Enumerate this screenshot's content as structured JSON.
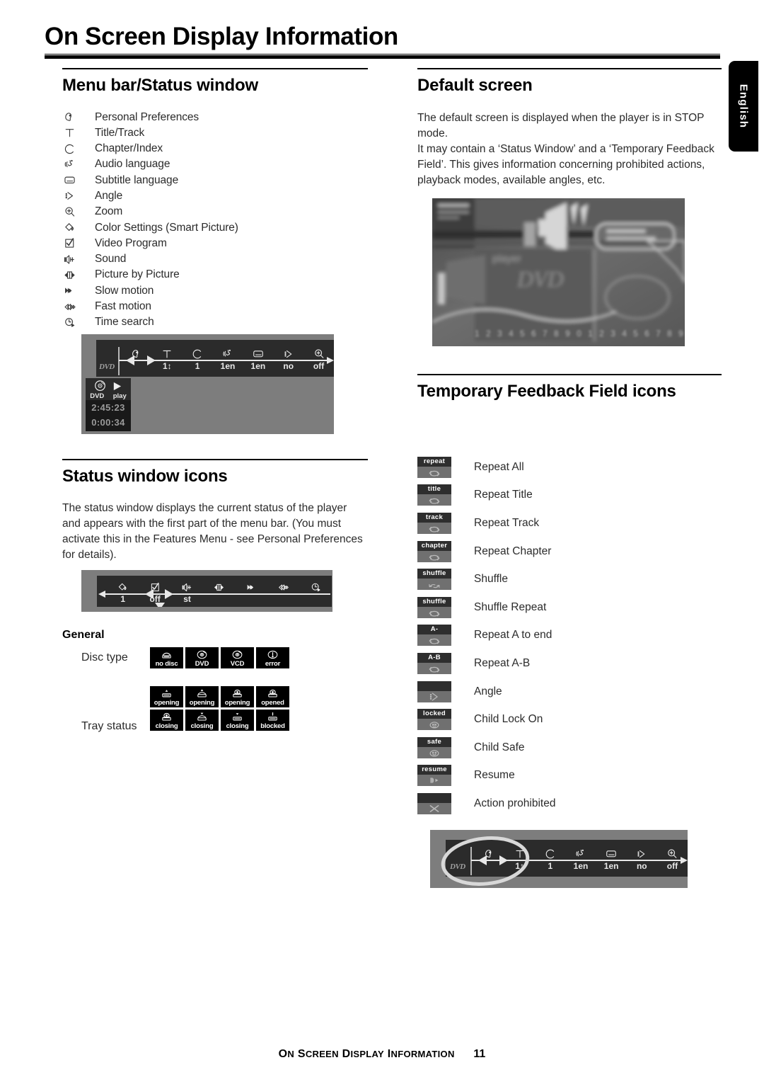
{
  "page": {
    "title": "On Screen Display Information",
    "language_tab": "English",
    "footer_title_parts": [
      "O",
      "N ",
      " S",
      "CREEN ",
      " D",
      "ISPLAY ",
      " I",
      "NFORMATION"
    ],
    "footer_title": "ON SCREEN DISPLAY INFORMATION",
    "page_number": "11"
  },
  "left_column": {
    "section1": {
      "heading": "Menu bar/Status window",
      "items": [
        {
          "icon": "personal-preferences-icon",
          "label": "Personal Preferences"
        },
        {
          "icon": "title-track-icon",
          "label": "Title/Track"
        },
        {
          "icon": "chapter-index-icon",
          "label": "Chapter/Index"
        },
        {
          "icon": "audio-language-icon",
          "label": "Audio language"
        },
        {
          "icon": "subtitle-language-icon",
          "label": "Subtitle language"
        },
        {
          "icon": "angle-icon",
          "label": "Angle"
        },
        {
          "icon": "zoom-icon",
          "label": "Zoom"
        },
        {
          "icon": "color-settings-icon",
          "label": "Color Settings (Smart Picture)"
        },
        {
          "icon": "video-program-icon",
          "label": "Video Program"
        },
        {
          "icon": "sound-icon",
          "label": "Sound"
        },
        {
          "icon": "picture-by-picture-icon",
          "label": "Picture by Picture"
        },
        {
          "icon": "slow-motion-icon",
          "label": "Slow motion"
        },
        {
          "icon": "fast-motion-icon",
          "label": "Fast motion"
        },
        {
          "icon": "time-search-icon",
          "label": "Time search"
        }
      ]
    },
    "menubar_figure": {
      "disc_logo": "DVD",
      "cells": [
        {
          "icon": "personal-preferences-icon",
          "value": ""
        },
        {
          "icon": "title-track-icon",
          "value": "1"
        },
        {
          "icon": "chapter-index-icon",
          "value": "1"
        },
        {
          "icon": "audio-language-icon",
          "value": "1en"
        },
        {
          "icon": "subtitle-language-icon",
          "value": "1en"
        },
        {
          "icon": "angle-icon",
          "value": "no"
        },
        {
          "icon": "zoom-icon",
          "value": "off"
        }
      ],
      "status_window": {
        "disc_type": "DVD",
        "state": "play",
        "total_time": "2:45:23",
        "elapsed_time": "0:00:34"
      }
    },
    "section2": {
      "heading": "Status window icons",
      "paragraph": "The status window displays the current status of the player and appears with the first part of the menu bar. (You must activate this in the Features Menu - see Personal Preferences for details).",
      "figure_cells": [
        {
          "icon": "color-settings-icon",
          "value": "1"
        },
        {
          "icon": "video-program-icon",
          "value": "off"
        },
        {
          "icon": "sound-icon",
          "value": "st"
        },
        {
          "icon": "picture-by-picture-icon",
          "value": ""
        },
        {
          "icon": "slow-motion-icon",
          "value": ""
        },
        {
          "icon": "fast-motion-icon",
          "value": ""
        },
        {
          "icon": "time-search-icon",
          "value": ""
        }
      ]
    },
    "general": {
      "heading": "General",
      "disc_type_label": "Disc type",
      "disc_type_icons": [
        {
          "caption": "no disc",
          "glyph": "tray-empty-icon"
        },
        {
          "caption": "DVD",
          "glyph": "disc-icon"
        },
        {
          "caption": "VCD",
          "glyph": "disc-icon"
        },
        {
          "caption": "error",
          "glyph": "exclamation-icon"
        }
      ],
      "tray_status_label": "Tray status",
      "tray_status_icons": [
        {
          "caption": "opening",
          "glyph": "tray-closed-up-icon"
        },
        {
          "caption": "opening",
          "glyph": "tray-open-up-icon"
        },
        {
          "caption": "opening",
          "glyph": "tray-disc-icon"
        },
        {
          "caption": "opened",
          "glyph": "tray-disc-icon"
        },
        {
          "caption": "closing",
          "glyph": "tray-disc-icon"
        },
        {
          "caption": "closing",
          "glyph": "tray-open-down-icon"
        },
        {
          "caption": "closing",
          "glyph": "tray-closed-down-icon"
        },
        {
          "caption": "blocked",
          "glyph": "tray-blocked-icon"
        }
      ]
    }
  },
  "right_column": {
    "section1": {
      "heading": "Default screen",
      "paragraph1": "The default screen is displayed when the player is in STOP mode.",
      "paragraph2": "It may contain a ‘Status Window’ and a ‘Temporary Feedback Field’. This gives information concerning prohibited actions, playback modes, available angles, etc."
    },
    "section2": {
      "heading": "Temporary Feedback Field icons",
      "items": [
        {
          "badge": "repeat",
          "glyph": "loop-icon",
          "label": "Repeat All"
        },
        {
          "badge": "title",
          "glyph": "loop-icon",
          "label": "Repeat Title"
        },
        {
          "badge": "track",
          "glyph": "loop-icon",
          "label": "Repeat Track"
        },
        {
          "badge": "chapter",
          "glyph": "loop-icon",
          "label": "Repeat Chapter"
        },
        {
          "badge": "shuffle",
          "glyph": "shuffle-icon",
          "label": "Shuffle"
        },
        {
          "badge": "shuffle",
          "glyph": "loop-icon",
          "label": "Shuffle Repeat"
        },
        {
          "badge": "A-",
          "glyph": "loop-icon",
          "label": "Repeat A to end"
        },
        {
          "badge": "A-B",
          "glyph": "loop-icon",
          "label": "Repeat A-B"
        },
        {
          "badge": "",
          "glyph": "angle-icon",
          "label": "Angle"
        },
        {
          "badge": "locked",
          "glyph": "lock-face-icon",
          "label": "Child Lock On"
        },
        {
          "badge": "safe",
          "glyph": "smiley-face-icon",
          "label": "Child Safe"
        },
        {
          "badge": "resume",
          "glyph": "resume-play-icon",
          "label": "Resume"
        },
        {
          "badge": "",
          "glyph": "cross-icon",
          "label": "Action prohibited"
        }
      ]
    },
    "menubar_figure": {
      "disc_logo": "DVD",
      "cells": [
        {
          "icon": "personal-preferences-icon",
          "value": ""
        },
        {
          "icon": "title-track-icon",
          "value": "1"
        },
        {
          "icon": "chapter-index-icon",
          "value": "1"
        },
        {
          "icon": "audio-language-icon",
          "value": "1en"
        },
        {
          "icon": "subtitle-language-icon",
          "value": "1en"
        },
        {
          "icon": "angle-icon",
          "value": "no"
        },
        {
          "icon": "zoom-icon",
          "value": "off"
        }
      ],
      "annotation": "highlight-ellipse"
    }
  },
  "colors": {
    "page_bg": "#ffffff",
    "ink": "#000000",
    "body_text": "#2b2b2b",
    "osd_bar": "#2b2b2b",
    "osd_frame": "#7d7d7d",
    "badge_bg": "#707070",
    "badge_top": "#2e2e2e"
  }
}
